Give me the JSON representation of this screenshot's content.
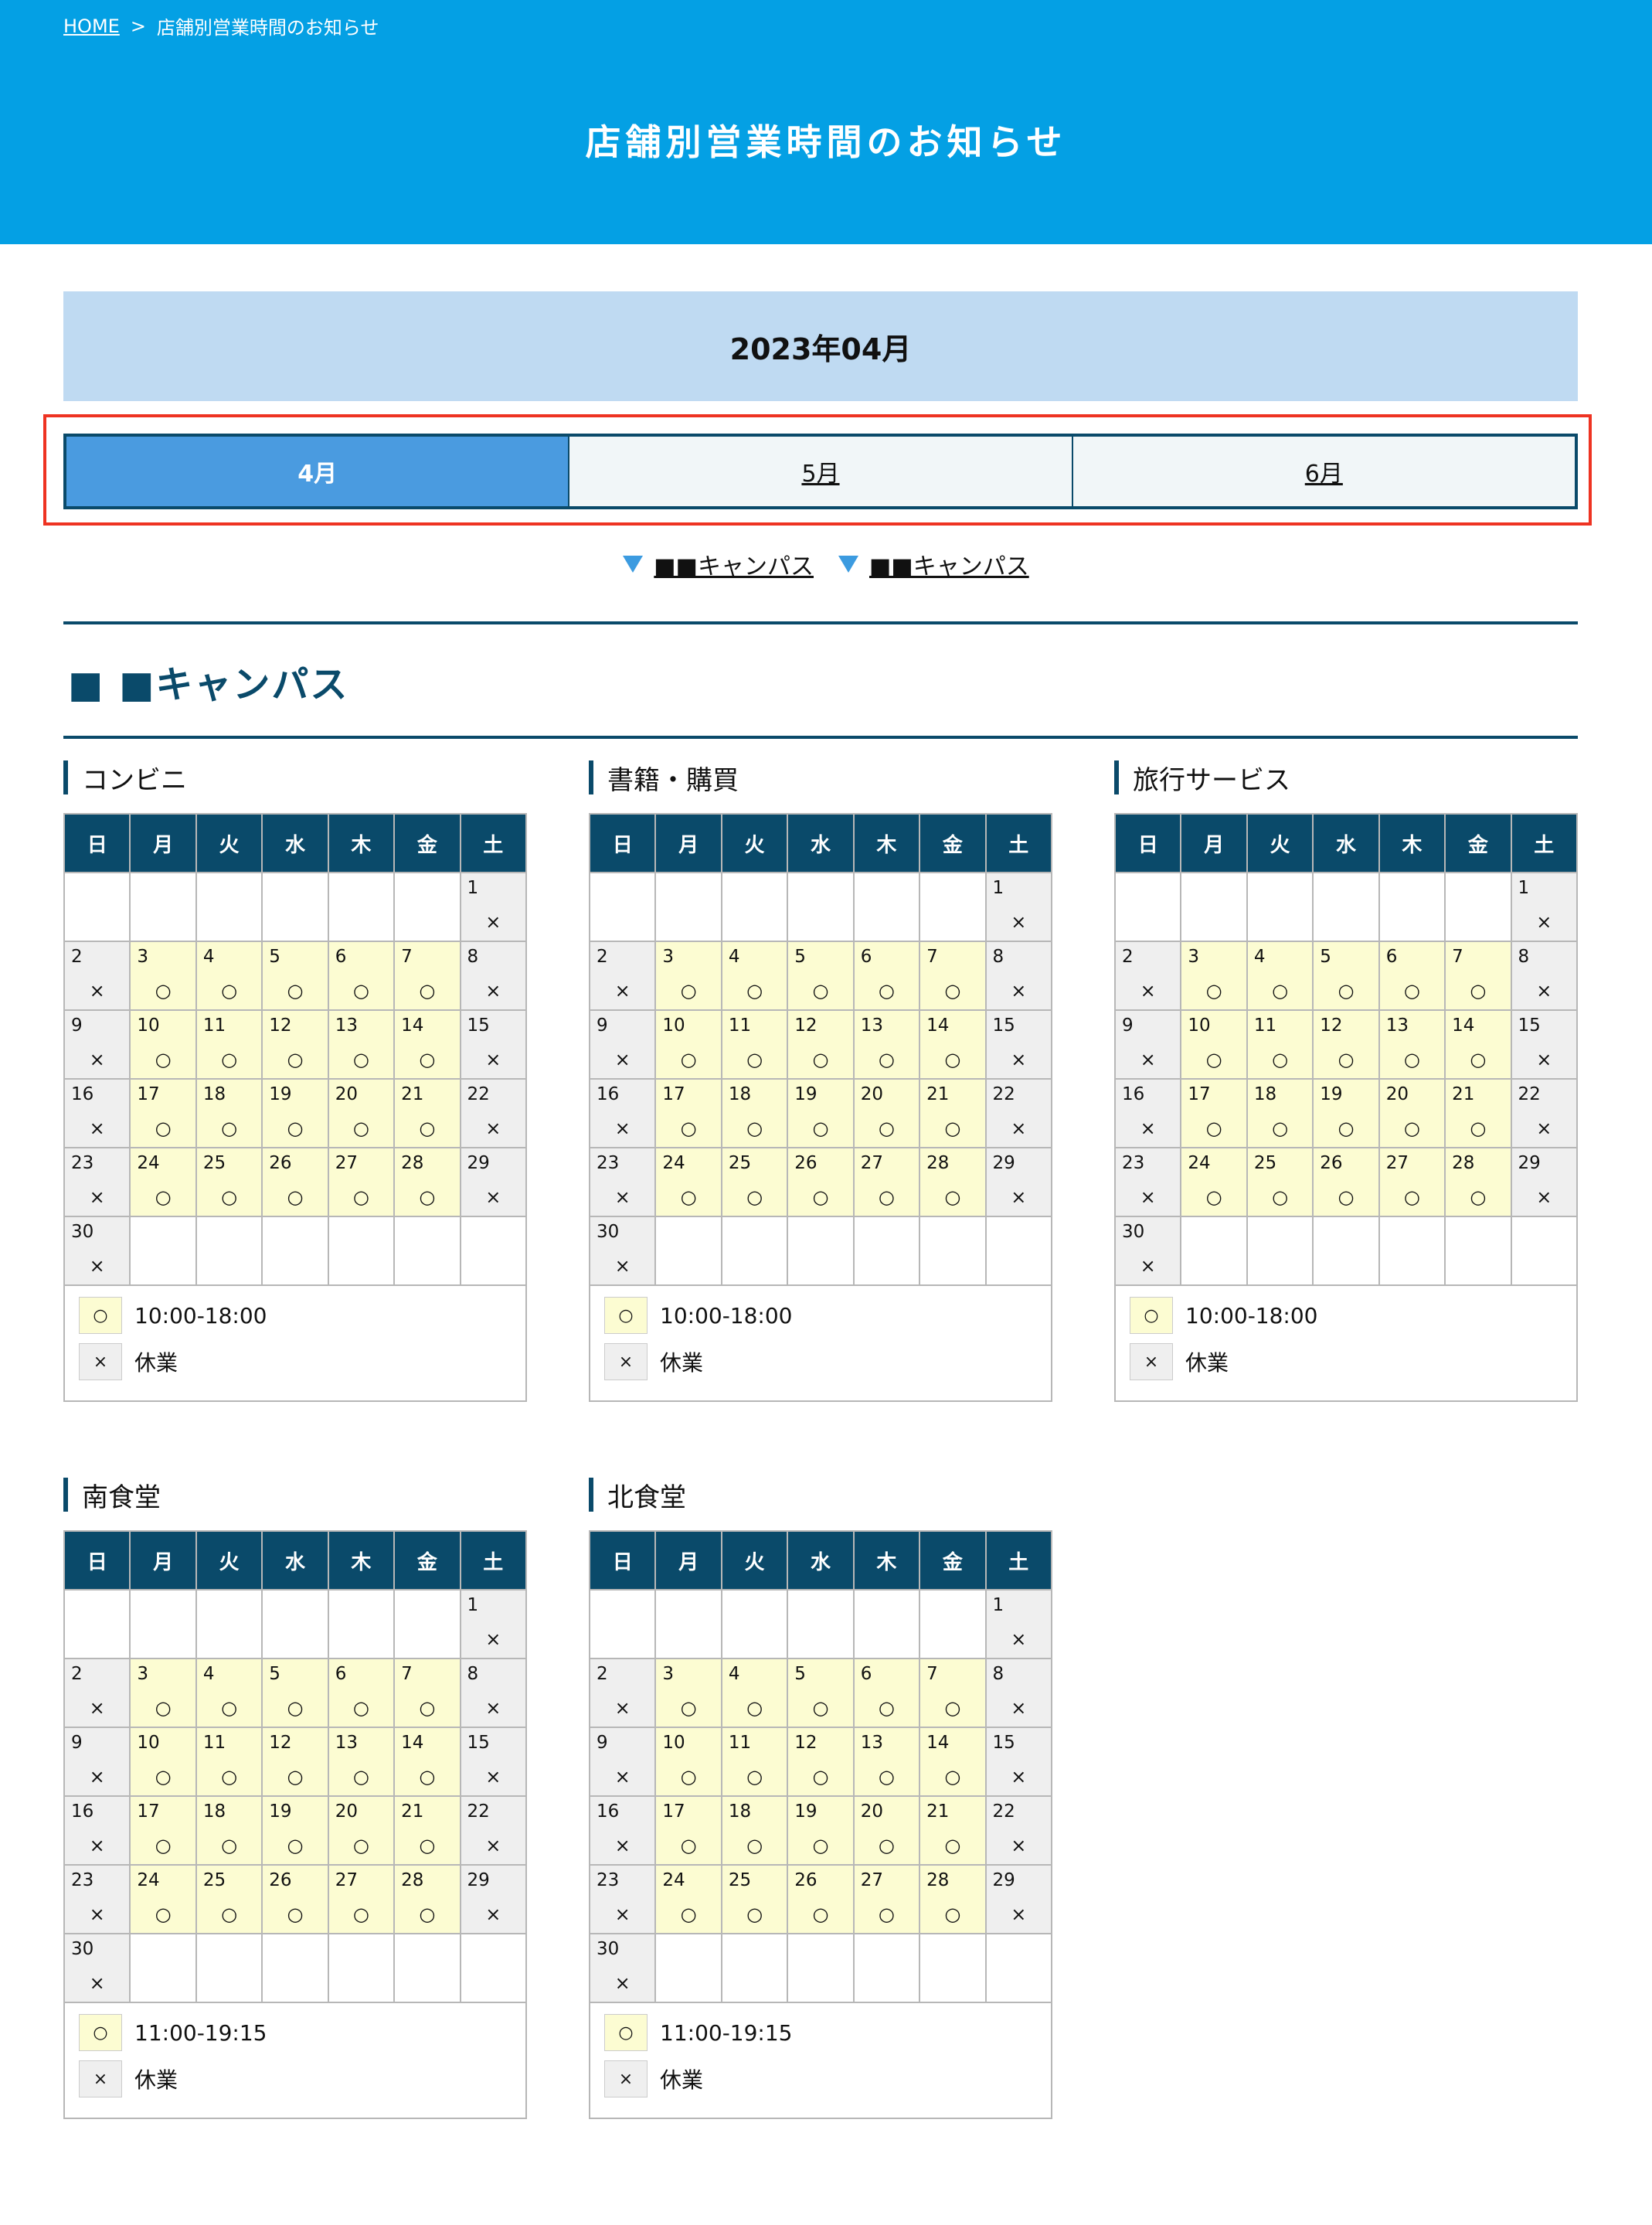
{
  "breadcrumb": {
    "home": "HOME",
    "separator": ">",
    "current": "店舗別営業時間のお知らせ"
  },
  "page_title": "店舗別営業時間のお知らせ",
  "month_banner": "2023年04月",
  "tabs": [
    {
      "label": "4月",
      "active": true
    },
    {
      "label": "5月",
      "active": false
    },
    {
      "label": "6月",
      "active": false
    }
  ],
  "anchor_links": [
    "■■キャンパス",
    "■■キャンパス"
  ],
  "section_title": "■ ■キャンパス",
  "weekday_headers": [
    "日",
    "月",
    "火",
    "水",
    "木",
    "金",
    "土"
  ],
  "marks": {
    "open": "○",
    "closed": "×"
  },
  "stores": [
    {
      "name": "コンビニ",
      "hours": "10:00-18:00",
      "closed_label": "休業"
    },
    {
      "name": "書籍・購買",
      "hours": "10:00-18:00",
      "closed_label": "休業"
    },
    {
      "name": "旅行サービス",
      "hours": "10:00-18:00",
      "closed_label": "休業"
    },
    {
      "name": "南食堂",
      "hours": "11:00-19:15",
      "closed_label": "休業"
    },
    {
      "name": "北食堂",
      "hours": "11:00-19:15",
      "closed_label": "休業"
    }
  ],
  "calendar_rows": [
    [
      null,
      null,
      null,
      null,
      null,
      null,
      {
        "day": "1",
        "status": "closed"
      }
    ],
    [
      {
        "day": "2",
        "status": "closed"
      },
      {
        "day": "3",
        "status": "open"
      },
      {
        "day": "4",
        "status": "open"
      },
      {
        "day": "5",
        "status": "open"
      },
      {
        "day": "6",
        "status": "open"
      },
      {
        "day": "7",
        "status": "open"
      },
      {
        "day": "8",
        "status": "closed"
      }
    ],
    [
      {
        "day": "9",
        "status": "closed"
      },
      {
        "day": "10",
        "status": "open"
      },
      {
        "day": "11",
        "status": "open"
      },
      {
        "day": "12",
        "status": "open"
      },
      {
        "day": "13",
        "status": "open"
      },
      {
        "day": "14",
        "status": "open"
      },
      {
        "day": "15",
        "status": "closed"
      }
    ],
    [
      {
        "day": "16",
        "status": "closed"
      },
      {
        "day": "17",
        "status": "open"
      },
      {
        "day": "18",
        "status": "open"
      },
      {
        "day": "19",
        "status": "open"
      },
      {
        "day": "20",
        "status": "open"
      },
      {
        "day": "21",
        "status": "open"
      },
      {
        "day": "22",
        "status": "closed"
      }
    ],
    [
      {
        "day": "23",
        "status": "closed"
      },
      {
        "day": "24",
        "status": "open"
      },
      {
        "day": "25",
        "status": "open"
      },
      {
        "day": "26",
        "status": "open"
      },
      {
        "day": "27",
        "status": "open"
      },
      {
        "day": "28",
        "status": "open"
      },
      {
        "day": "29",
        "status": "closed"
      }
    ],
    [
      {
        "day": "30",
        "status": "closed"
      },
      null,
      null,
      null,
      null,
      null,
      null
    ]
  ],
  "colors": {
    "header_blue": "#04a0e4",
    "banner": "#bfdaf2",
    "navy": "#0a4a6a",
    "active_tab": "#4a9be0",
    "open_cell": "#fcfcd2",
    "closed_cell": "#efefef",
    "highlight": "#ee3322"
  }
}
